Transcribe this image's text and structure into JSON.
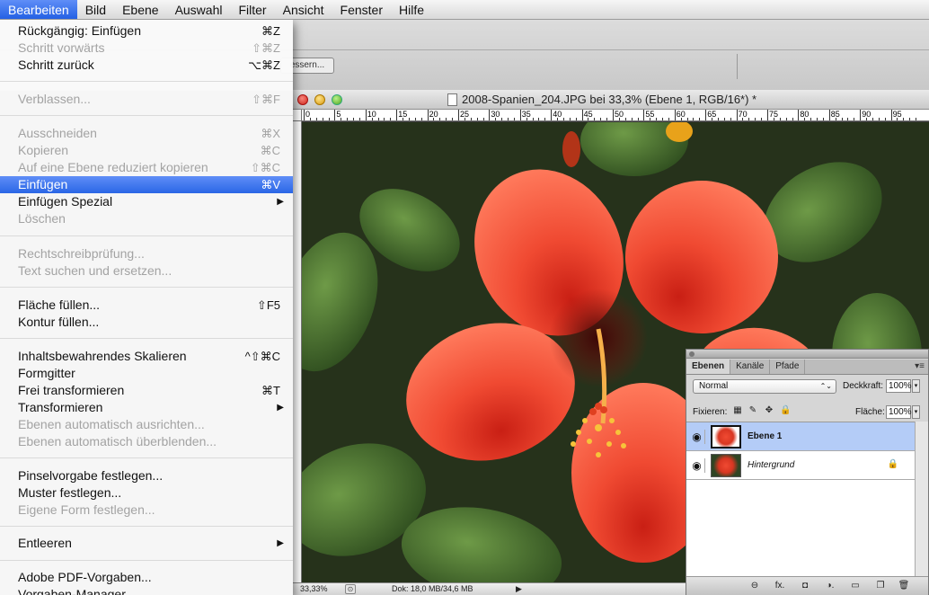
{
  "menubar": {
    "items": [
      "Bearbeiten",
      "Bild",
      "Ebene",
      "Auswahl",
      "Filter",
      "Ansicht",
      "Fenster",
      "Hilfe"
    ]
  },
  "bg_toolbar": {
    "ghost_button": "essern..."
  },
  "menu": {
    "items": [
      {
        "label": "Rückgängig: Einfügen",
        "shortcut": "⌘Z"
      },
      {
        "label": "Schritt vorwärts",
        "shortcut": "⇧⌘Z"
      },
      {
        "label": "Schritt zurück",
        "shortcut": "⌥⌘Z"
      },
      {
        "label": "Verblassen...",
        "shortcut": "⇧⌘F"
      },
      {
        "label": "Ausschneiden",
        "shortcut": "⌘X"
      },
      {
        "label": "Kopieren",
        "shortcut": "⌘C"
      },
      {
        "label": "Auf eine Ebene reduziert kopieren",
        "shortcut": "⇧⌘C"
      },
      {
        "label": "Einfügen",
        "shortcut": "⌘V"
      },
      {
        "label": "Einfügen Spezial",
        "submenu": "▶"
      },
      {
        "label": "Löschen"
      },
      {
        "label": "Rechtschreibprüfung..."
      },
      {
        "label": "Text suchen und ersetzen..."
      },
      {
        "label": "Fläche füllen...",
        "shortcut": "⇧F5"
      },
      {
        "label": "Kontur füllen..."
      },
      {
        "label": "Inhaltsbewahrendes Skalieren",
        "shortcut": "^⇧⌘C"
      },
      {
        "label": "Formgitter"
      },
      {
        "label": "Frei transformieren",
        "shortcut": "⌘T"
      },
      {
        "label": "Transformieren",
        "submenu": "▶"
      },
      {
        "label": "Ebenen automatisch ausrichten..."
      },
      {
        "label": "Ebenen automatisch überblenden..."
      },
      {
        "label": "Pinselvorgabe festlegen..."
      },
      {
        "label": "Muster festlegen..."
      },
      {
        "label": "Eigene Form festlegen..."
      },
      {
        "label": "Entleeren",
        "submenu": "▶"
      },
      {
        "label": "Adobe PDF-Vorgaben..."
      },
      {
        "label": "Vorgaben-Manager..."
      }
    ]
  },
  "document": {
    "title": "2008-Spanien_204.JPG bei 33,3% (Ebene 1, RGB/16*) *",
    "ruler_labels": [
      "0",
      "5",
      "10",
      "15",
      "20",
      "25",
      "30",
      "35",
      "40",
      "45",
      "50",
      "55",
      "60",
      "65",
      "70",
      "75",
      "80",
      "85",
      "90",
      "95"
    ],
    "zoom": "33,33%",
    "doc_size": "Dok: 18,0 MB/34,6 MB",
    "status_arrow": "▶"
  },
  "layers_panel": {
    "tabs": [
      "Ebenen",
      "Kanäle",
      "Pfade"
    ],
    "menu_icon": "▾≡",
    "blend_mode": "Normal",
    "opacity_label": "Deckkraft:",
    "opacity_value": "100%",
    "lock_label": "Fixieren:",
    "fill_label": "Fläche:",
    "fill_value": "100%",
    "layers": [
      {
        "name": "Ebene 1",
        "selected": true
      },
      {
        "name": "Hintergrund",
        "selected": false,
        "locked": true
      }
    ],
    "footer_icons": [
      "link-icon",
      "fx-icon",
      "mask-icon",
      "adjustment-icon",
      "folder-icon",
      "new-layer-icon",
      "trash-icon"
    ],
    "footer_glyphs": {
      "link": "⊖",
      "fx": "fx.",
      "mask": "◘",
      "adjust": "◑.",
      "folder": "▭",
      "new": "❐",
      "trash": "🗑"
    },
    "lock_glyphs": {
      "transparency": "▦",
      "paint": "✎",
      "move": "✥",
      "all": "🔒"
    },
    "layer_lock_glyph": "🔒",
    "eye_glyph": "◉",
    "stepper_glyph": "▾"
  },
  "colors": {
    "menu_highlight": "#2a66e6",
    "layer_selected": "#b4ccf7",
    "flower_red": "#f04a32"
  }
}
